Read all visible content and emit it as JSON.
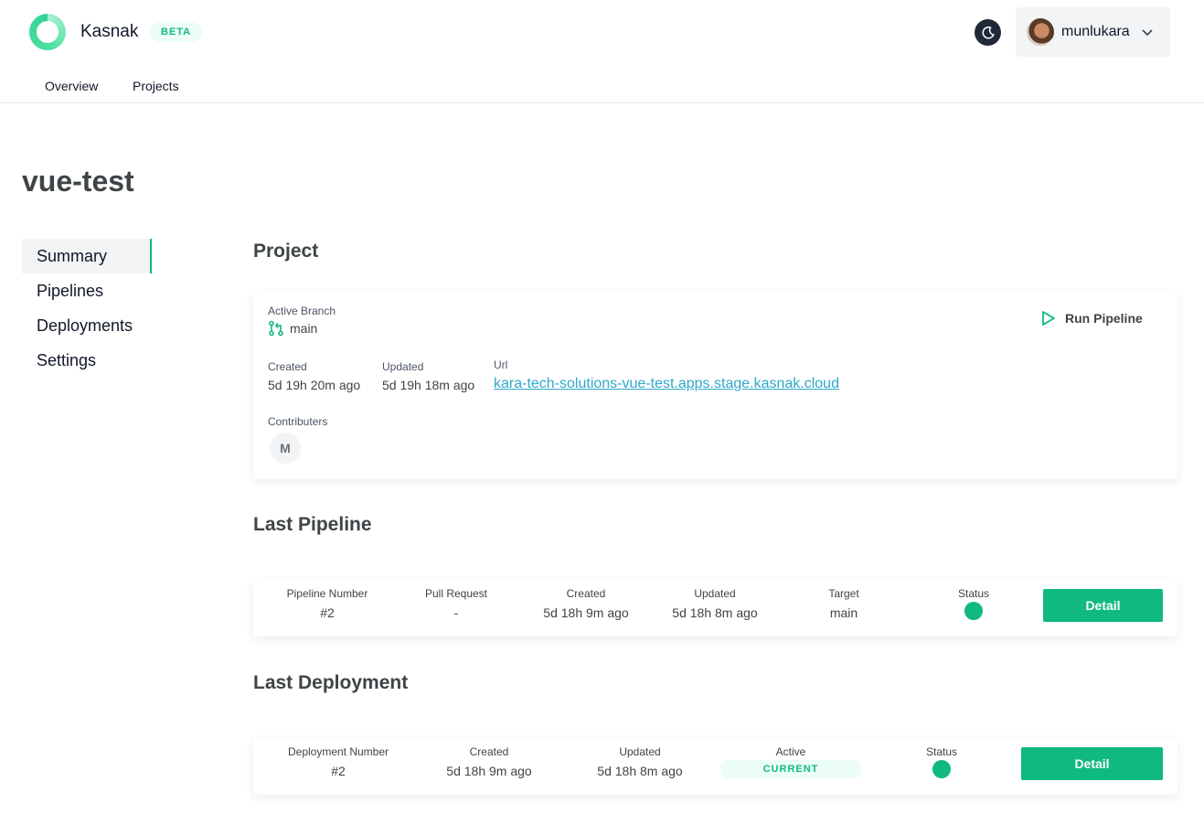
{
  "header": {
    "brand": "Kasnak",
    "badge": "BETA",
    "username": "munlukara",
    "nav": [
      "Overview",
      "Projects"
    ]
  },
  "page": {
    "title": "vue-test"
  },
  "sidebar": {
    "items": [
      "Summary",
      "Pipelines",
      "Deployments",
      "Settings"
    ],
    "active": "Summary"
  },
  "project": {
    "section_title": "Project",
    "active_branch_label": "Active Branch",
    "branch": "main",
    "run_pipeline": "Run Pipeline",
    "created_label": "Created",
    "created": "5d 19h 20m ago",
    "updated_label": "Updated",
    "updated": "5d 19h 18m ago",
    "url_label": "Url",
    "url": "kara-tech-solutions-vue-test.apps.stage.kasnak.cloud",
    "contributors_label": "Contributers",
    "contributors": [
      "M"
    ]
  },
  "last_pipeline": {
    "section_title": "Last Pipeline",
    "number_label": "Pipeline Number",
    "number": "#2",
    "pr_label": "Pull Request",
    "pr": "-",
    "created_label": "Created",
    "created": "5d 18h 9m ago",
    "updated_label": "Updated",
    "updated": "5d 18h 8m ago",
    "target_label": "Target",
    "target": "main",
    "status_label": "Status",
    "status_color": "#10b981",
    "detail": "Detail"
  },
  "last_deployment": {
    "section_title": "Last Deployment",
    "number_label": "Deployment Number",
    "number": "#2",
    "created_label": "Created",
    "created": "5d 18h 9m ago",
    "updated_label": "Updated",
    "updated": "5d 18h 8m ago",
    "active_label": "Active",
    "active": "CURRENT",
    "status_label": "Status",
    "status_color": "#10b981",
    "detail": "Detail"
  },
  "colors": {
    "accent": "#10b981",
    "link": "#2ea8c9"
  },
  "icons": {
    "theme": "moon-icon",
    "menu": "chevron-down-icon",
    "branch": "git-branch-icon",
    "run": "play-icon"
  }
}
